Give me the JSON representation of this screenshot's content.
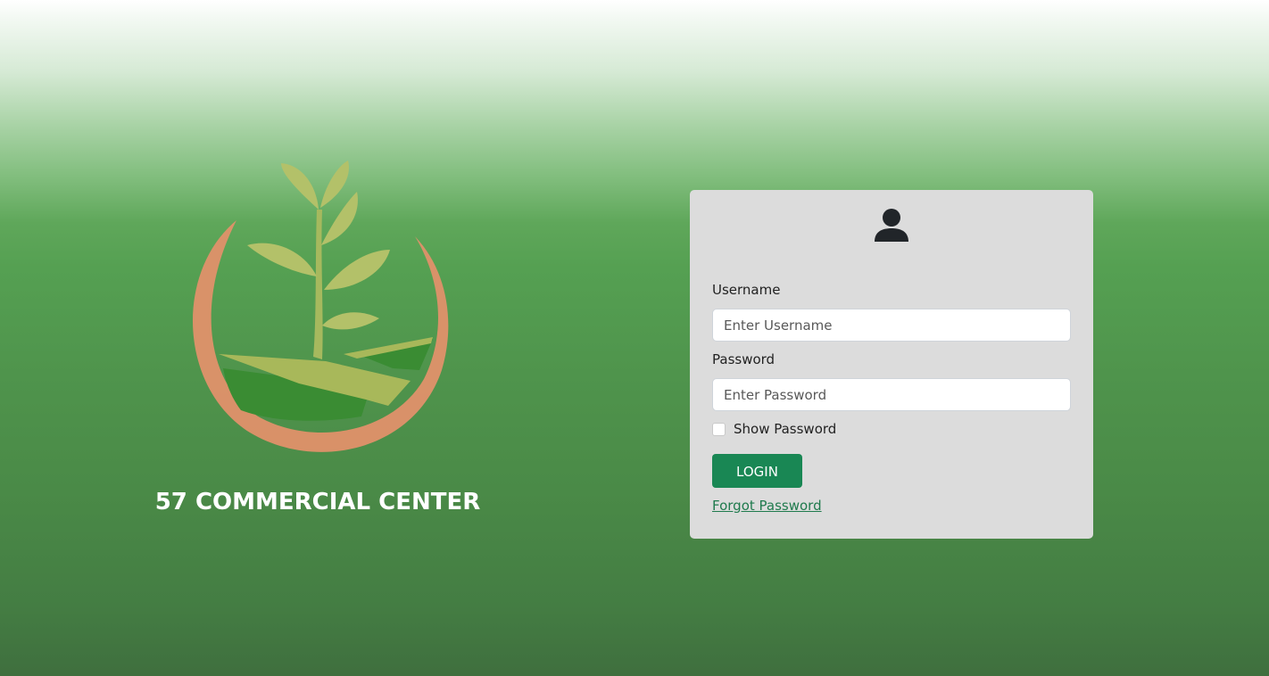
{
  "brand": {
    "company_name": "57 COMMERCIAL CENTER",
    "logo_icon": "plant-sprout-logo-icon"
  },
  "login": {
    "user_icon": "user-icon",
    "username_label": "Username",
    "username_placeholder": "Enter Username",
    "username_value": "",
    "password_label": "Password",
    "password_placeholder": "Enter Password",
    "password_value": "",
    "show_password_label": "Show Password",
    "show_password_checked": false,
    "login_button_label": "LOGIN",
    "forgot_password_label": "Forgot Password"
  },
  "colors": {
    "primary_button": "#198754",
    "card_background": "#dcdcdc",
    "link": "#1f7a4d",
    "background_top": "#ffffff",
    "background_mid": "#55a052",
    "background_bottom": "#3f6f3e"
  }
}
